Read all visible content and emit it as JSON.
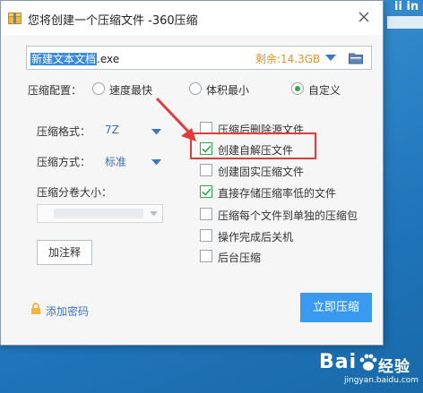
{
  "desktop": {
    "corner_text": "ii  in",
    "watermark": {
      "brand": "Bai",
      "brand2": "经验",
      "url": "jingyan.baidu.com"
    }
  },
  "window": {
    "title": "您将创建一个压缩文件 -360压缩",
    "icon": "archive-icon"
  },
  "path": {
    "filename_selected": "新建文本文档",
    "filename_ext": ".exe",
    "space_left": "剩余:14.3GB"
  },
  "config": {
    "label": "压缩配置：",
    "options": [
      {
        "label": "速度最快",
        "selected": false
      },
      {
        "label": "体积最小",
        "selected": false
      },
      {
        "label": "自定义",
        "selected": true
      }
    ]
  },
  "format": {
    "label": "压缩格式：",
    "value": "7Z"
  },
  "method": {
    "label": "压缩方式：",
    "value": "标准"
  },
  "volume": {
    "label": "压缩分卷大小：",
    "value": ""
  },
  "comment_button": "加注释",
  "options": [
    {
      "label": "压缩后删除源文件",
      "checked": false
    },
    {
      "label": "创建自解压文件",
      "checked": true
    },
    {
      "label": "创建固实压缩文件",
      "checked": false
    },
    {
      "label": "直接存储压缩率低的文件",
      "checked": true
    },
    {
      "label": "压缩每个文件到单独的压缩包",
      "checked": false
    },
    {
      "label": "操作完成后关机",
      "checked": false
    },
    {
      "label": "后台压缩",
      "checked": false
    }
  ],
  "add_password": "添加密码",
  "compress_button": "立即压缩",
  "colors": {
    "accent": "#3a9af0",
    "warn": "#f0901c",
    "check": "#2fa84f",
    "highlight": "#e23b3b"
  }
}
